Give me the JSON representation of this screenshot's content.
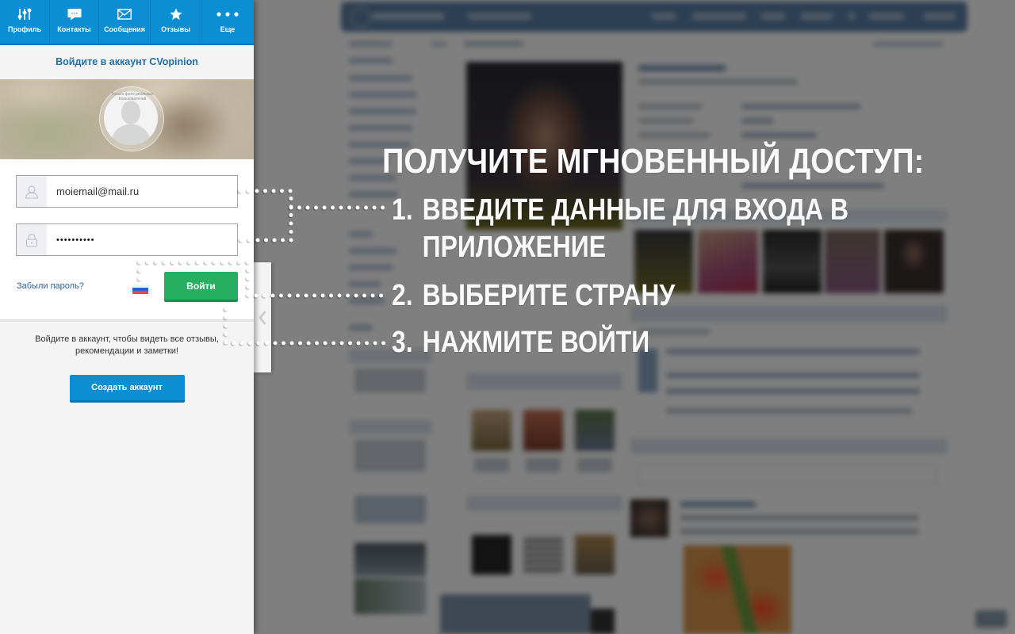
{
  "colors": {
    "primary": "#0c8ed5",
    "success": "#27ae60",
    "title": "#1f6fa5",
    "link": "#2d6392"
  },
  "nav": {
    "tabs": [
      {
        "label": "Профиль",
        "icon": "sliders-icon"
      },
      {
        "label": "Контакты",
        "icon": "chat-bubble-icon"
      },
      {
        "label": "Сообщения",
        "icon": "envelope-icon"
      },
      {
        "label": "Отзывы",
        "icon": "star-icon"
      },
      {
        "label": "Еще",
        "icon": "more-dots-icon"
      }
    ]
  },
  "login": {
    "title": "Войдите в аккаунт CVopinion",
    "avatar_caption": "Только фото реальных пользователей",
    "email": {
      "value": "moiemail@mail.ru",
      "icon": "user-icon"
    },
    "password": {
      "value": "••••••••••",
      "icon": "lock-icon"
    },
    "forgot_password": "Забыли пароль?",
    "country": {
      "code": "RU",
      "icon": "russia-flag-icon"
    },
    "submit": "Войти"
  },
  "signup": {
    "prompt": "Войдите в аккаунт, чтобы видеть все отзывы, рекомендации и заметки!",
    "button": "Создать аккаунт"
  },
  "collapse_tab": {
    "icon": "chevron-left-icon"
  },
  "promo": {
    "headline": "ПОЛУЧИТЕ МГНОВЕННЫЙ ДОСТУП:",
    "steps": [
      {
        "number": "1.",
        "text": "ВВЕДИТЕ ДАННЫЕ ДЛЯ ВХОДА В ПРИЛОЖЕНИЕ"
      },
      {
        "number": "2.",
        "text": "ВЫБЕРИТЕ СТРАНУ"
      },
      {
        "number": "3.",
        "text": "НАЖМИТЕ ВОЙТИ"
      }
    ]
  }
}
